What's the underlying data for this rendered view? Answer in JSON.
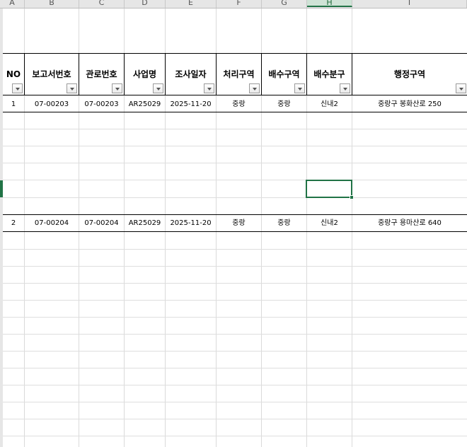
{
  "sheet": {
    "column_letters": [
      "A",
      "B",
      "C",
      "D",
      "E",
      "F",
      "G",
      "H",
      "I"
    ],
    "selected_column": "H",
    "header": [
      "NO",
      "보고서번호",
      "관로번호",
      "사업명",
      "조사일자",
      "처리구역",
      "배수구역",
      "배수분구",
      "행정구역"
    ],
    "rows": [
      [
        "1",
        "07-00203",
        "07-00203",
        "AR25029",
        "2025-11-20",
        "중랑",
        "중랑",
        "신내2",
        "중랑구 봉화산로 250"
      ],
      [
        "2",
        "07-00204",
        "07-00204",
        "AR25029",
        "2025-11-20",
        "중랑",
        "중랑",
        "신내2",
        "중랑구 용마산로 640"
      ]
    ]
  },
  "colors": {
    "accent": "#217346",
    "grid": "#dadada"
  }
}
